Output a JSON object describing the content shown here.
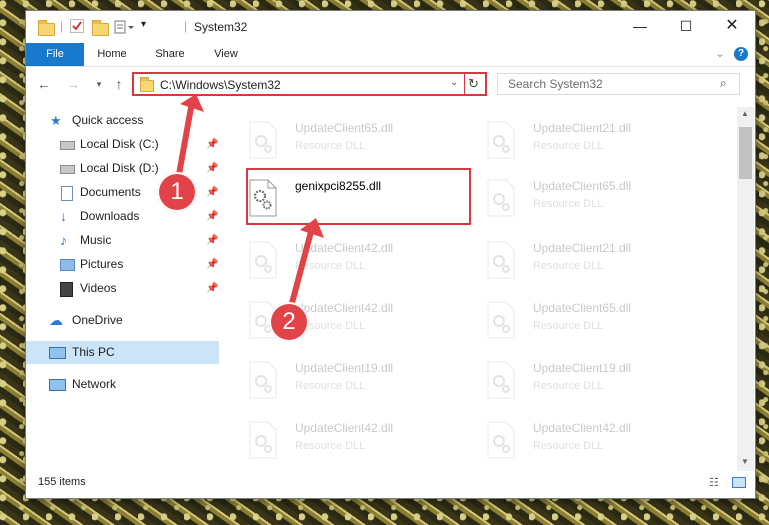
{
  "window": {
    "title": "System32"
  },
  "ribbon": {
    "tabs": [
      "File",
      "Home",
      "Share",
      "View"
    ]
  },
  "address": {
    "path": "C:\\Windows\\System32"
  },
  "search": {
    "placeholder": "Search System32"
  },
  "sidebar": {
    "items": [
      {
        "label": "Quick access",
        "icon": "star-icon"
      },
      {
        "label": "Local Disk (C:)",
        "icon": "drive-icon",
        "pinned": true
      },
      {
        "label": "Local Disk (D:)",
        "icon": "drive-icon",
        "pinned": true
      },
      {
        "label": "Documents",
        "icon": "documents-icon",
        "pinned": true
      },
      {
        "label": "Downloads",
        "icon": "download-icon",
        "pinned": true
      },
      {
        "label": "Music",
        "icon": "music-icon",
        "pinned": true
      },
      {
        "label": "Pictures",
        "icon": "pictures-icon",
        "pinned": true
      },
      {
        "label": "Videos",
        "icon": "videos-icon",
        "pinned": true
      },
      {
        "label": "OneDrive",
        "icon": "cloud-icon"
      },
      {
        "label": "This PC",
        "icon": "computer-icon",
        "selected": true
      },
      {
        "label": "Network",
        "icon": "network-icon"
      }
    ]
  },
  "files": [
    {
      "name": "UpdateClient65.dll",
      "type": "Resource DLL",
      "faded": true
    },
    {
      "name": "UpdateClient21.dll",
      "type": "Resource DLL",
      "faded": true
    },
    {
      "name": "genixpci8255.dll",
      "type": "",
      "faded": false,
      "highlighted": true
    },
    {
      "name": "UpdateClient65.dll",
      "type": "Resource DLL",
      "faded": true
    },
    {
      "name": "UpdateClient42.dll",
      "type": "Resource DLL",
      "faded": true
    },
    {
      "name": "UpdateClient21.dll",
      "type": "Resource DLL",
      "faded": true
    },
    {
      "name": "UpdateClient42.dll",
      "type": "Resource DLL",
      "faded": true
    },
    {
      "name": "UpdateClient65.dll",
      "type": "Resource DLL",
      "faded": true
    },
    {
      "name": "UpdateClient19.dll",
      "type": "Resource DLL",
      "faded": true
    },
    {
      "name": "UpdateClient19.dll",
      "type": "Resource DLL",
      "faded": true
    },
    {
      "name": "UpdateClient42.dll",
      "type": "Resource DLL",
      "faded": true
    },
    {
      "name": "UpdateClient42.dll",
      "type": "Resource DLL",
      "faded": true
    }
  ],
  "status": {
    "item_count": "155 items"
  },
  "annotations": {
    "step1": "1",
    "step2": "2"
  },
  "colors": {
    "accent": "#1979ca",
    "highlight": "#d9363e",
    "selected": "#cce4f7"
  }
}
